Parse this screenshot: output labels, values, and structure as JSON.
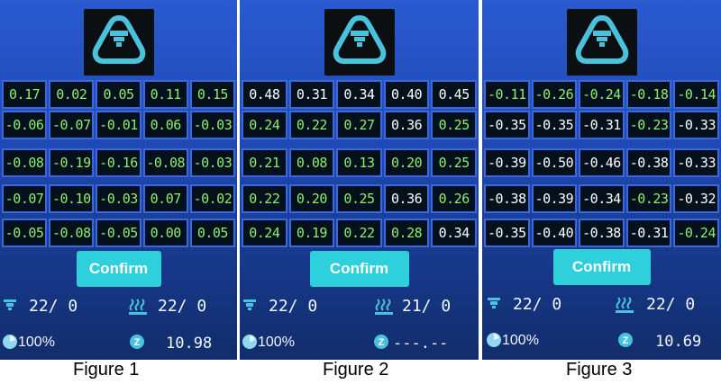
{
  "panels": [
    {
      "caption": "Figure 1",
      "confirm_label": "Confirm",
      "grid": [
        [
          "0.17",
          "0.02",
          "0.05",
          "0.11",
          "0.15"
        ],
        [
          "-0.06",
          "-0.07",
          "-0.01",
          "0.06",
          "-0.03"
        ],
        [
          "-0.08",
          "-0.19",
          "-0.16",
          "-0.08",
          "-0.03"
        ],
        [
          "-0.07",
          "-0.10",
          "-0.03",
          "0.07",
          "-0.02"
        ],
        [
          "-0.05",
          "-0.08",
          "-0.05",
          "0.00",
          "0.05"
        ]
      ],
      "colors": [
        [
          "g",
          "g",
          "g",
          "g",
          "g"
        ],
        [
          "g",
          "g",
          "g",
          "g",
          "g"
        ],
        [
          "g",
          "g",
          "g",
          "g",
          "g"
        ],
        [
          "g",
          "g",
          "g",
          "g",
          "g"
        ],
        [
          "g",
          "g",
          "g",
          "g",
          "g"
        ]
      ],
      "nozzle_temp": "22/  0",
      "bed_temp": "22/  0",
      "fan_speed": "100%",
      "z_offset": "10.98"
    },
    {
      "caption": "Figure 2",
      "confirm_label": "Confirm",
      "grid": [
        [
          "0.48",
          "0.31",
          "0.34",
          "0.40",
          "0.45"
        ],
        [
          "0.24",
          "0.22",
          "0.27",
          "0.36",
          "0.25"
        ],
        [
          "0.21",
          "0.08",
          "0.13",
          "0.20",
          "0.25"
        ],
        [
          "0.22",
          "0.20",
          "0.25",
          "0.36",
          "0.26"
        ],
        [
          "0.24",
          "0.19",
          "0.22",
          "0.28",
          "0.34"
        ]
      ],
      "colors": [
        [
          "w",
          "w",
          "w",
          "w",
          "w"
        ],
        [
          "g",
          "g",
          "g",
          "w",
          "g"
        ],
        [
          "g",
          "g",
          "g",
          "g",
          "g"
        ],
        [
          "g",
          "g",
          "g",
          "w",
          "g"
        ],
        [
          "g",
          "g",
          "g",
          "g",
          "w"
        ]
      ],
      "nozzle_temp": "22/  0",
      "bed_temp": "21/  0",
      "fan_speed": "100%",
      "z_offset": "---.--"
    },
    {
      "caption": "Figure 3",
      "confirm_label": "Confirm",
      "grid": [
        [
          "-0.11",
          "-0.26",
          "-0.24",
          "-0.18",
          "-0.14"
        ],
        [
          "-0.35",
          "-0.35",
          "-0.31",
          "-0.23",
          "-0.33"
        ],
        [
          "-0.39",
          "-0.50",
          "-0.46",
          "-0.38",
          "-0.33"
        ],
        [
          "-0.38",
          "-0.39",
          "-0.34",
          "-0.23",
          "-0.32"
        ],
        [
          "-0.35",
          "-0.40",
          "-0.38",
          "-0.31",
          "-0.24"
        ]
      ],
      "colors": [
        [
          "g",
          "g",
          "g",
          "g",
          "g"
        ],
        [
          "w",
          "w",
          "w",
          "g",
          "w"
        ],
        [
          "w",
          "w",
          "w",
          "w",
          "w"
        ],
        [
          "w",
          "w",
          "w",
          "g",
          "w"
        ],
        [
          "w",
          "w",
          "w",
          "w",
          "g"
        ]
      ],
      "nozzle_temp": "22/  0",
      "bed_temp": "22/  0",
      "fan_speed": "100%",
      "z_offset": "10.69"
    }
  ],
  "palette": {
    "green": "#8cf06a",
    "white": "#ffffff",
    "accent": "#2ed0dc",
    "icon": "#49c2de"
  },
  "icons": {
    "logo": "nozzle-triangle-icon",
    "nozzle": "nozzle-icon",
    "bed": "heatbed-icon",
    "fan": "fan-icon",
    "z": "z-axis-icon"
  }
}
